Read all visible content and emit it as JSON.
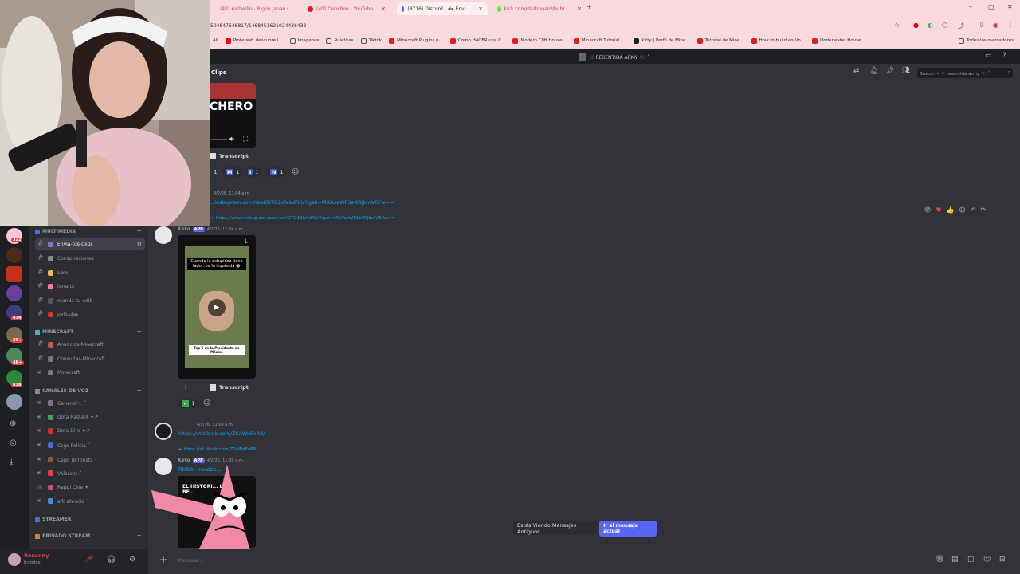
{
  "browser": {
    "tabs": [
      {
        "label": "(43) Aishwillo - Big In Japan (...",
        "close": "×"
      },
      {
        "label": "(49) Cerv.hoo - YouTube",
        "close": "×"
      },
      {
        "label": "(8716) Discord | #▸ Envi...",
        "close": "×"
      },
      {
        "label": "kick.com/dashboard/hub/...",
        "close": "×"
      }
    ],
    "new_tab": "+",
    "address": "504847646817/1468451621024436433",
    "bookmarks": [
      "Pinterest: descubre i...",
      "Imagenes",
      "Ruletitas",
      "Tiktok",
      "Minecraft Plugins p...",
      "Como HACER una C...",
      "Modern Cliff House...",
      "Minecraft Tutorial |...",
      "kitty | Perfil de Mine...",
      "Tutorial de Mine...",
      "How to build an Un...",
      "Underwater House..."
    ],
    "bookmarks_all": "Todos los marcadores",
    "apps_label": "All"
  },
  "title_bar": {
    "server": "♡ RESENTIDA ARMY ♡.･ﾟ"
  },
  "channel_header": {
    "name": "Clips",
    "search_placeholder": "Buscar ✧ ♡ resentida army ♡.･ﾟ"
  },
  "video_top": {
    "caption": "CHERO"
  },
  "transcript_label": "Transcript",
  "reactions_top": [
    {
      "emoji": "M",
      "count": "1"
    },
    {
      "emoji": "I",
      "count": "1"
    },
    {
      "emoji": "N",
      "count": "1"
    }
  ],
  "reaction_lead_count": "1",
  "msg1": {
    "meta": "4/2/26, 11:04 a.m.",
    "link": "...instagram.com/reel/DTO2dlekdR6/?igsh=MXAxeWF3eXRjbmV6Yw=="
  },
  "msg2": {
    "reply_link": "https://www.instagram.com/reel/DTO2dlekdR6/?igsh=MXAxeWF3eXRjbmV6Yw==",
    "author": "Keto",
    "app_tag": "APP",
    "meta": "4/2/26, 11:04 a.m.",
    "video_caption": "Cuando la estupidez tiene lado ..pa la izquierda 😂",
    "video_banner": "Top 5 de la Presidenta de México",
    "transcript_label": "Transcript",
    "info_icon": "i",
    "reaction_count": "1"
  },
  "msg3": {
    "meta": "4/2/26, 11:09 a.m.",
    "link": "https://vt.tiktok.com/ZSaWeFvR8/"
  },
  "msg4": {
    "reply_link": "https://vt.tiktok.com/ZSaWeFvR8/",
    "author": "Keto",
    "app_tag": "APP",
    "meta": "4/2/26, 11:09 a.m.",
    "text": "TikTok · ruustic...",
    "preview_text": "EL HISTORI... LA BE..."
  },
  "old_messages": {
    "label": "Estás Viendo Mensajes Antiguos",
    "button": "Ir al mensaje actual"
  },
  "composer": {
    "placeholder": "Mensaje..."
  },
  "user": {
    "name": "Roxanny",
    "status": "Invisible"
  },
  "server_badges": [
    "322",
    "434",
    "39+",
    "4K+",
    "838"
  ],
  "categories": [
    {
      "label": "MULTIMEDIA",
      "channels": [
        "Envia-tus-Clips",
        "Conspiraciones",
        "Lore",
        "fanarts",
        "manda-tu-edit",
        "peliculas"
      ]
    },
    {
      "label": "MINECRAFT",
      "channels": [
        "Anuncios-Minecraft",
        "Consultas-Minecraft",
        "Minecraft"
      ]
    },
    {
      "label": "CANALES DE VOZ",
      "channels": [
        "General♡.･ﾟ",
        "Dota Radiant ✦.*",
        "Dota Dire ✦.*",
        "Csgo Policia ·ﾟ",
        "Csgo Terrorista ·ﾟ",
        "Valorant ·ﾟ",
        "Rappi Cine ✦",
        "afk silencio ·ﾟ"
      ]
    },
    {
      "label": "STREAMER",
      "channels": []
    },
    {
      "label": "PRIVADO STREAM",
      "channels": []
    }
  ],
  "colors": {
    "blurple": "#5865f2",
    "link": "#00a8fc",
    "bg": "#313338",
    "sidebar": "#2b2d31",
    "rail": "#1e1f22"
  }
}
